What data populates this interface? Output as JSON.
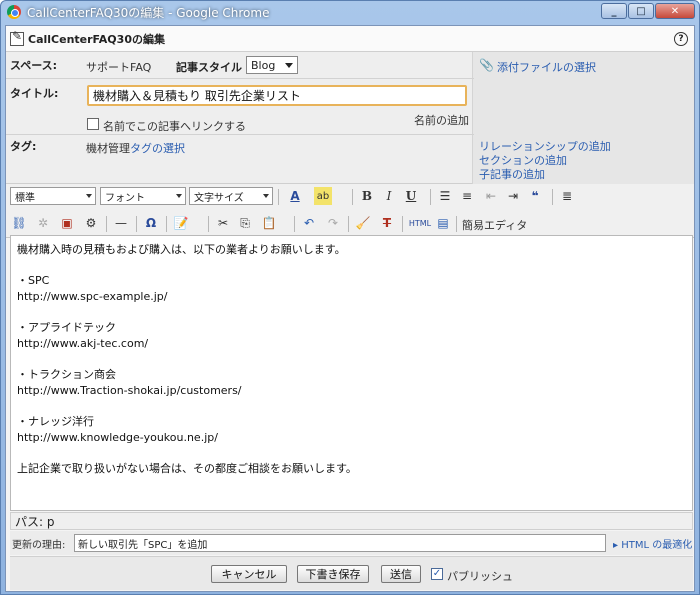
{
  "window": {
    "title": "CallCenterFAQ30の編集 - Google Chrome"
  },
  "header": {
    "page_title": "CallCenterFAQ30の編集",
    "help": "?"
  },
  "form": {
    "space_label": "スペース:",
    "space_value": "サポートFAQ",
    "style_label": "記事スタイル",
    "style_value": "Blog",
    "title_label": "タイトル:",
    "title_value": "機材購入＆見積もり 取引先企業リスト",
    "link_checkbox_label": "名前でこの記事へリンクする",
    "link_checked": false,
    "name_add_link": "名前の追加",
    "tag_label": "タグ:",
    "tag_value": "機材管理",
    "tag_select_link": "タグの選択"
  },
  "right_links": {
    "attach": "添付ファイルの選択",
    "relationship": "リレーションシップの追加",
    "section": "セクションの追加",
    "child": "子記事の追加"
  },
  "toolbar": {
    "format_combo": "標準",
    "font_combo": "フォント",
    "size_combo": "文字サイズ",
    "simple_editor": "簡易エディタ",
    "html_label": "HTML"
  },
  "editor": {
    "intro": "機材購入時の見積もおよび購入は、以下の業者よりお願いします。",
    "vendors": [
      {
        "name": "・SPC",
        "url": "http://www.spc-example.jp/"
      },
      {
        "name": "・アプライドテック",
        "url": "http://www.akj-tec.com/"
      },
      {
        "name": "・トラクション商会",
        "url": "http://www.Traction-shokai.jp/customers/"
      },
      {
        "name": "・ナレッジ洋行",
        "url": "http://www.knowledge-youkou.ne.jp/"
      }
    ],
    "closing": "上記企業で取り扱いがない場合は、その都度ご相談をお願いします。"
  },
  "status": {
    "path": "パス: p"
  },
  "reason": {
    "label": "更新の理由:",
    "value": "新しい取引先「SPC」を追加",
    "html_optimize": "HTML の最適化"
  },
  "actions": {
    "cancel": "キャンセル",
    "draft": "下書き保存",
    "submit": "送信",
    "publish_label": "パブリッシュ",
    "publish_checked": true
  }
}
